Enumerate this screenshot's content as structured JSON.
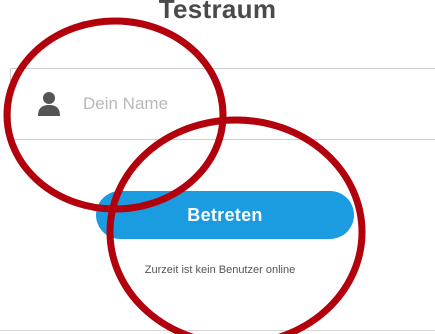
{
  "room": {
    "title": "Testraum"
  },
  "login": {
    "name_placeholder": "Dein Name",
    "name_value": "",
    "user_icon": "user-icon",
    "enter_label": "Betreten",
    "online_status": "Zurzeit ist kein Benutzer online"
  },
  "colors": {
    "accent": "#1b9be0",
    "annotation": "#b3000d"
  }
}
